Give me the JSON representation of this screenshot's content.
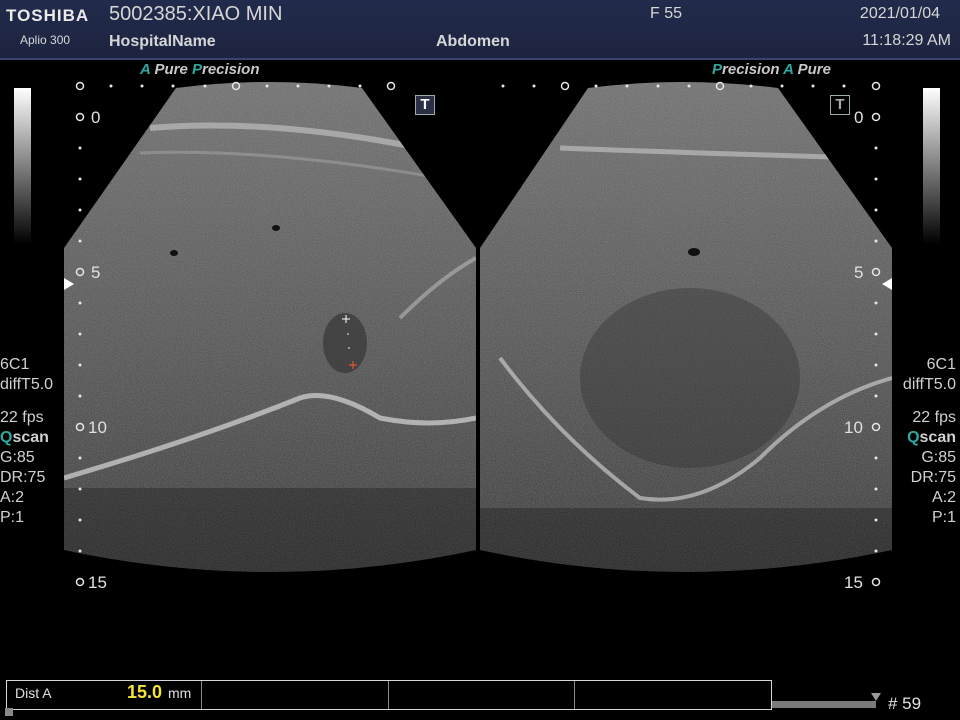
{
  "header": {
    "brand": "TOSHIBA",
    "model": "Aplio 300",
    "patient": "5002385:XIAO MIN",
    "hospital": "HospitalName",
    "exam": "Abdomen",
    "frame_label": "F  55",
    "date": "2021/01/04",
    "time": "11:18:29 AM"
  },
  "tags": {
    "left": {
      "a1": "A",
      "t1": " Pure ",
      "a2": "P",
      "t2": "recision"
    },
    "right": {
      "a1": "P",
      "t1": "recision  ",
      "a2": "A",
      "t2": " Pure"
    }
  },
  "t_marker": "T",
  "depth_scale": {
    "d0": "0",
    "d5": "5",
    "d10": "10",
    "d15": "15"
  },
  "params": {
    "probe": "6C1",
    "mode": "diffT5.0",
    "fps": "22 fps",
    "scan_q": "Q",
    "scan_rest": "scan",
    "gain": "G:85",
    "dr": "DR:75",
    "a": "A:2",
    "p": "P:1"
  },
  "measurement": {
    "label": "Dist A",
    "value": "15.0",
    "unit": "mm"
  },
  "frame_count": "# 59",
  "colors": {
    "accent": "#2fa8a0",
    "header_bg": "#1c2440",
    "value_yellow": "#f4e43a"
  }
}
